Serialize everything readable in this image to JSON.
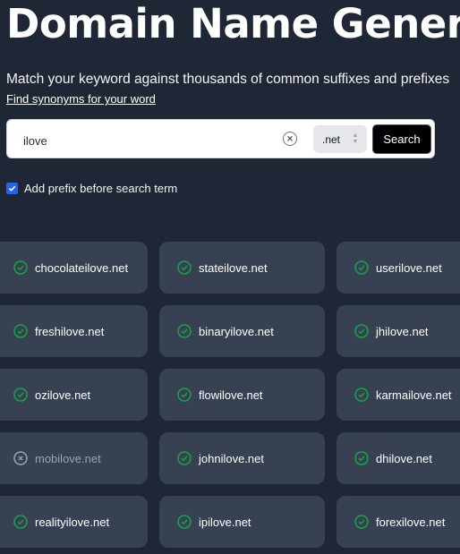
{
  "header": {
    "title": "Domain Name Generator",
    "subtitle": "Match your keyword against thousands of common suffixes and prefixes",
    "synonyms_link": "Find synonyms for your word"
  },
  "search": {
    "value": "ilove",
    "placeholder": "",
    "clear_icon": "x-circle-icon",
    "tld_selected": ".net",
    "button_label": "Search"
  },
  "options": {
    "add_prefix_label": "Add prefix before search term",
    "add_prefix_checked": true
  },
  "colors": {
    "background": "#1f2737",
    "card": "#374151",
    "available": "#16a34a",
    "taken": "#9ca3af",
    "checkbox": "#2563eb"
  },
  "results": [
    {
      "domain": "chocolateilove.net",
      "available": true
    },
    {
      "domain": "stateilove.net",
      "available": true
    },
    {
      "domain": "userilove.net",
      "available": true
    },
    {
      "domain": "freshilove.net",
      "available": true
    },
    {
      "domain": "binaryilove.net",
      "available": true
    },
    {
      "domain": "jhilove.net",
      "available": true
    },
    {
      "domain": "ozilove.net",
      "available": true
    },
    {
      "domain": "flowilove.net",
      "available": true
    },
    {
      "domain": "karmailove.net",
      "available": true
    },
    {
      "domain": "mobilove.net",
      "available": false
    },
    {
      "domain": "johnilove.net",
      "available": true
    },
    {
      "domain": "dhilove.net",
      "available": true
    },
    {
      "domain": "realityilove.net",
      "available": true
    },
    {
      "domain": "ipilove.net",
      "available": true
    },
    {
      "domain": "forexilove.net",
      "available": true
    }
  ]
}
